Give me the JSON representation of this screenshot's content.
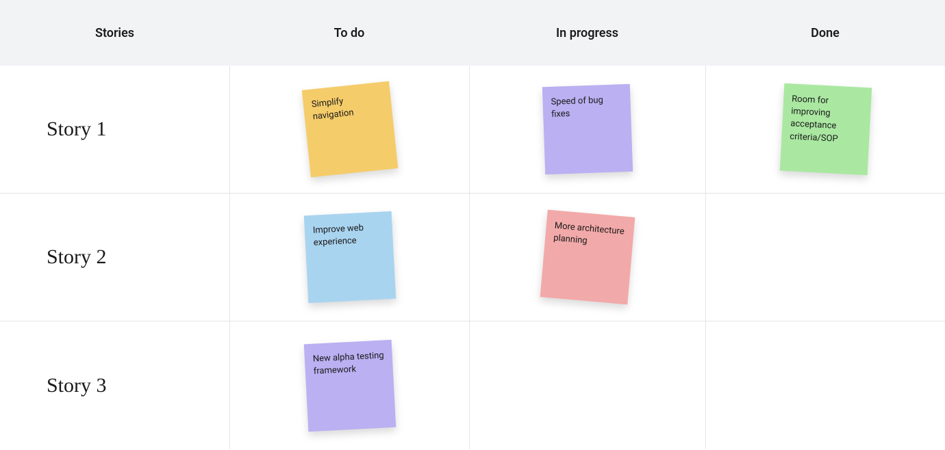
{
  "columns": {
    "stories": "Stories",
    "todo": "To do",
    "in_progress": "In progress",
    "done": "Done"
  },
  "rows": [
    {
      "story": "Story 1",
      "todo": {
        "text": "Simplify navigation",
        "color": "yellow",
        "rot": "rot-neg6"
      },
      "in_progress": {
        "text": "Speed of bug fixes",
        "color": "purple",
        "rot": "rot-neg2"
      },
      "done": {
        "text": "Room for improving acceptance criteria/SOP",
        "color": "green",
        "rot": "rot-pos3"
      }
    },
    {
      "story": "Story 2",
      "todo": {
        "text": "Improve web experience",
        "color": "blue",
        "rot": "rot-neg3"
      },
      "in_progress": {
        "text": "More architecture planning",
        "color": "pink",
        "rot": "rot-pos5"
      },
      "done": null
    },
    {
      "story": "Story 3",
      "todo": {
        "text": "New alpha testing framework",
        "color": "lilac",
        "rot": "rot-neg3"
      },
      "in_progress": null,
      "done": null
    }
  ]
}
